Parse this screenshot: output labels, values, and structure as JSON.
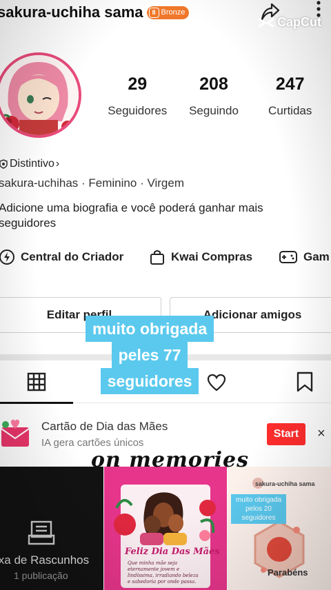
{
  "header": {
    "username": "sakura-uchiha sama",
    "badge_label": "Bronze",
    "watermark": "CapCut"
  },
  "profile": {
    "stats": [
      {
        "value": "29",
        "label": "Seguidores"
      },
      {
        "value": "208",
        "label": "Seguindo"
      },
      {
        "value": "247",
        "label": "Curtidas"
      }
    ],
    "distintivo": "Distintivo",
    "handle": "sakura-uchihas",
    "gender": "Feminino",
    "sign": "Virgem",
    "bio": "Adicione uma biografia e você poderá ganhar mais seguidores"
  },
  "shortcuts": [
    {
      "label": "Central do Criador",
      "icon": "lightning-icon"
    },
    {
      "label": "Kwai Compras",
      "icon": "shopping-bag-icon"
    },
    {
      "label": "Gam",
      "icon": "gamepad-icon"
    }
  ],
  "buttons": {
    "edit": "Editar perfil",
    "add": "Adicionar amigos"
  },
  "overlay_caption": [
    "muito obrigada",
    "peles 77",
    "seguidores"
  ],
  "promo": {
    "title": "Cartão de Dia das Mães",
    "subtitle": "IA gera cartões únicos",
    "action": "Start",
    "close": "×"
  },
  "memories_text": "on memories",
  "thumbnails": {
    "draft_title": "ixa de Rascunhos",
    "draft_sub": "1 publicação",
    "card_title": "Feliz Dia Das Mães",
    "card_text": "Que minha mãe seja eternamente jovem e lindíssima, irradiando beleza e sabedoria por onde passa.",
    "mini_user": "sakura-uchiha sama",
    "mini_caption": "muito obrigada pelos 20 seguidores",
    "parabens": "Parabéns"
  },
  "colors": {
    "accent_red": "#ff2d2d",
    "badge_orange": "#f0782a",
    "caption_blue": "#5bc9ee",
    "avatar_ring": "#e84a7a"
  }
}
